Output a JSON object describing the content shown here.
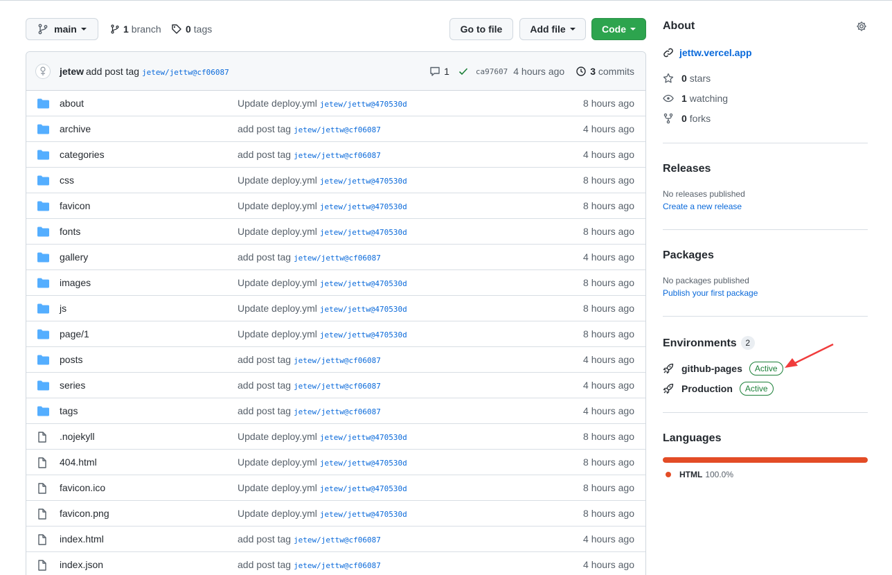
{
  "toolbar": {
    "branch_name": "main",
    "branch_count": "1",
    "branch_label": "branch",
    "tag_count": "0",
    "tag_label": "tags",
    "go_to_file": "Go to file",
    "add_file": "Add file",
    "code": "Code"
  },
  "latest_commit": {
    "author": "jetew",
    "message": "add post tag",
    "ref": "jetew/jettw@cf06087",
    "comments": "1",
    "sha": "ca97607",
    "age": "4 hours ago",
    "commit_count": "3",
    "commit_label": "commits"
  },
  "files": [
    {
      "name": "about",
      "type": "dir",
      "msg": "Update deploy.yml",
      "ref": "jetew/jettw@470530d",
      "age": "8 hours ago"
    },
    {
      "name": "archive",
      "type": "dir",
      "msg": "add post tag",
      "ref": "jetew/jettw@cf06087",
      "age": "4 hours ago"
    },
    {
      "name": "categories",
      "type": "dir",
      "msg": "add post tag",
      "ref": "jetew/jettw@cf06087",
      "age": "4 hours ago"
    },
    {
      "name": "css",
      "type": "dir",
      "msg": "Update deploy.yml",
      "ref": "jetew/jettw@470530d",
      "age": "8 hours ago"
    },
    {
      "name": "favicon",
      "type": "dir",
      "msg": "Update deploy.yml",
      "ref": "jetew/jettw@470530d",
      "age": "8 hours ago"
    },
    {
      "name": "fonts",
      "type": "dir",
      "msg": "Update deploy.yml",
      "ref": "jetew/jettw@470530d",
      "age": "8 hours ago"
    },
    {
      "name": "gallery",
      "type": "dir",
      "msg": "add post tag",
      "ref": "jetew/jettw@cf06087",
      "age": "4 hours ago"
    },
    {
      "name": "images",
      "type": "dir",
      "msg": "Update deploy.yml",
      "ref": "jetew/jettw@470530d",
      "age": "8 hours ago"
    },
    {
      "name": "js",
      "type": "dir",
      "msg": "Update deploy.yml",
      "ref": "jetew/jettw@470530d",
      "age": "8 hours ago"
    },
    {
      "name": "page/1",
      "type": "dir",
      "msg": "Update deploy.yml",
      "ref": "jetew/jettw@470530d",
      "age": "8 hours ago"
    },
    {
      "name": "posts",
      "type": "dir",
      "msg": "add post tag",
      "ref": "jetew/jettw@cf06087",
      "age": "4 hours ago"
    },
    {
      "name": "series",
      "type": "dir",
      "msg": "add post tag",
      "ref": "jetew/jettw@cf06087",
      "age": "4 hours ago"
    },
    {
      "name": "tags",
      "type": "dir",
      "msg": "add post tag",
      "ref": "jetew/jettw@cf06087",
      "age": "4 hours ago"
    },
    {
      "name": ".nojekyll",
      "type": "file",
      "msg": "Update deploy.yml",
      "ref": "jetew/jettw@470530d",
      "age": "8 hours ago"
    },
    {
      "name": "404.html",
      "type": "file",
      "msg": "Update deploy.yml",
      "ref": "jetew/jettw@470530d",
      "age": "8 hours ago"
    },
    {
      "name": "favicon.ico",
      "type": "file",
      "msg": "Update deploy.yml",
      "ref": "jetew/jettw@470530d",
      "age": "8 hours ago"
    },
    {
      "name": "favicon.png",
      "type": "file",
      "msg": "Update deploy.yml",
      "ref": "jetew/jettw@470530d",
      "age": "8 hours ago"
    },
    {
      "name": "index.html",
      "type": "file",
      "msg": "add post tag",
      "ref": "jetew/jettw@cf06087",
      "age": "4 hours ago"
    },
    {
      "name": "index.json",
      "type": "file",
      "msg": "add post tag",
      "ref": "jetew/jettw@cf06087",
      "age": "4 hours ago"
    }
  ],
  "sidebar": {
    "about_title": "About",
    "website": "jettw.vercel.app",
    "stars_count": "0",
    "stars_label": "stars",
    "watching_count": "1",
    "watching_label": "watching",
    "forks_count": "0",
    "forks_label": "forks",
    "releases_title": "Releases",
    "releases_empty": "No releases published",
    "releases_link": "Create a new release",
    "packages_title": "Packages",
    "packages_empty": "No packages published",
    "packages_link": "Publish your first package",
    "environments_title": "Environments",
    "environments_count": "2",
    "environments": [
      {
        "name": "github-pages",
        "status": "Active"
      },
      {
        "name": "Production",
        "status": "Active"
      }
    ],
    "languages_title": "Languages",
    "languages": [
      {
        "name": "HTML",
        "percent": "100.0%",
        "color": "#e34c26"
      }
    ]
  },
  "colors": {
    "folder": "#54aeff",
    "primary_button": "#2da44e",
    "link": "#0969da",
    "active_badge": "#1a7f37",
    "annotation_arrow": "#f03c3c"
  },
  "icons": {
    "branch": "git-branch-icon",
    "tag": "tag-icon",
    "folder": "folder-icon",
    "file": "file-icon",
    "history": "history-icon",
    "comment": "comment-icon",
    "check": "check-icon",
    "link": "link-icon",
    "star": "star-icon",
    "eye": "eye-icon",
    "fork": "repo-forked-icon",
    "rocket": "rocket-icon",
    "gear": "gear-icon"
  }
}
